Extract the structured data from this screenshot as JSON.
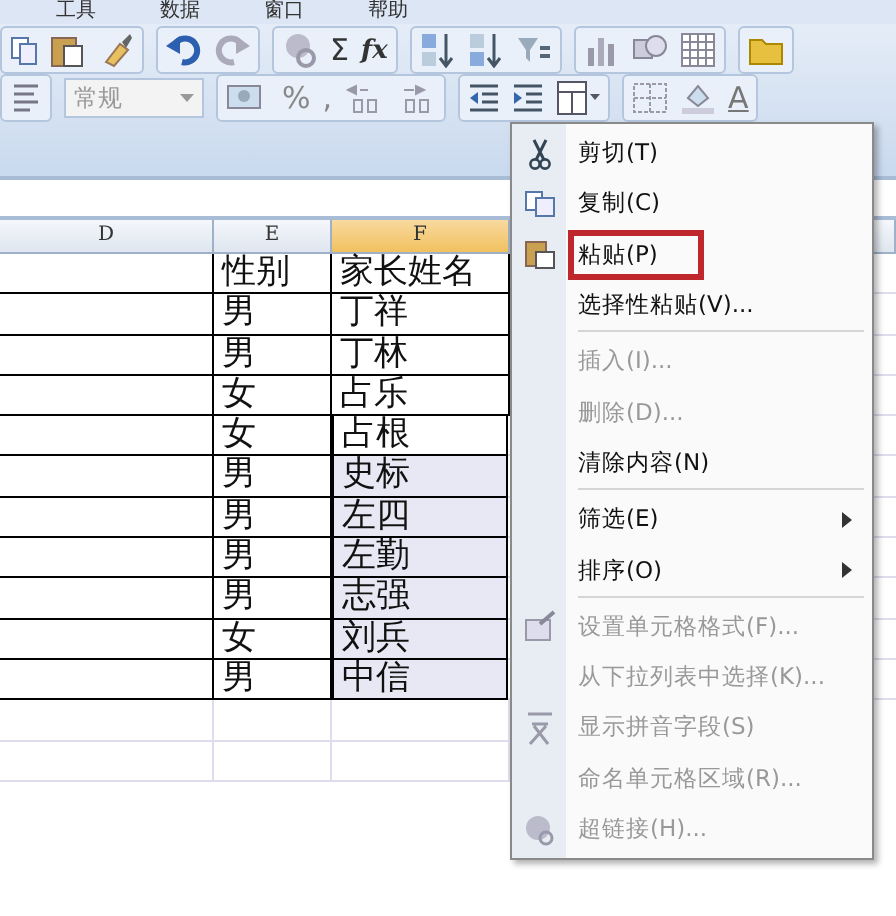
{
  "menubar": [
    {
      "label": "工具"
    },
    {
      "label": "数据"
    },
    {
      "label": "窗口"
    },
    {
      "label": "帮助"
    }
  ],
  "toolbar": {
    "sum_label": "Σ",
    "function_label": "fx",
    "number_format": {
      "value": "常规",
      "disabled": true
    },
    "percent_label": "%",
    "comma_label": ",",
    "font_color_label": "A"
  },
  "sheet": {
    "columns": [
      {
        "label": "D",
        "selected": false
      },
      {
        "label": "E",
        "selected": false
      },
      {
        "label": "F",
        "selected": true
      }
    ],
    "rows": [
      {
        "gender": "性别",
        "parent_name": "家长姓名",
        "selected": false
      },
      {
        "gender": "男",
        "parent_name": "丁祥",
        "selected": false
      },
      {
        "gender": "男",
        "parent_name": "丁林",
        "selected": false
      },
      {
        "gender": "女",
        "parent_name": "占乐",
        "selected": false
      },
      {
        "gender": "女",
        "parent_name": "占根",
        "selected": true
      },
      {
        "gender": "男",
        "parent_name": "史标",
        "selected": true
      },
      {
        "gender": "男",
        "parent_name": "左四",
        "selected": true
      },
      {
        "gender": "男",
        "parent_name": "左勤",
        "selected": true
      },
      {
        "gender": "男",
        "parent_name": "志强",
        "selected": true
      },
      {
        "gender": "女",
        "parent_name": "刘兵",
        "selected": true
      },
      {
        "gender": "男",
        "parent_name": "中信",
        "selected": true
      }
    ]
  },
  "context_menu": [
    {
      "label": "剪切(T)",
      "disabled": false,
      "submenu": false,
      "highlighted": false,
      "separator_before": false
    },
    {
      "label": "复制(C)",
      "disabled": false,
      "submenu": false,
      "highlighted": false,
      "separator_before": false
    },
    {
      "label": "粘贴(P)",
      "disabled": false,
      "submenu": false,
      "highlighted": true,
      "separator_before": false
    },
    {
      "label": "选择性粘贴(V)...",
      "disabled": false,
      "submenu": false,
      "highlighted": false,
      "separator_before": false
    },
    {
      "label": "插入(I)...",
      "disabled": true,
      "submenu": false,
      "highlighted": false,
      "separator_before": true
    },
    {
      "label": "删除(D)...",
      "disabled": true,
      "submenu": false,
      "highlighted": false,
      "separator_before": false
    },
    {
      "label": "清除内容(N)",
      "disabled": false,
      "submenu": false,
      "highlighted": false,
      "separator_before": false
    },
    {
      "label": "筛选(E)",
      "disabled": false,
      "submenu": true,
      "highlighted": false,
      "separator_before": true
    },
    {
      "label": "排序(O)",
      "disabled": false,
      "submenu": true,
      "highlighted": false,
      "separator_before": false
    },
    {
      "label": "设置单元格格式(F)...",
      "disabled": true,
      "submenu": false,
      "highlighted": false,
      "separator_before": true
    },
    {
      "label": "从下拉列表中选择(K)...",
      "disabled": true,
      "submenu": false,
      "highlighted": false,
      "separator_before": false
    },
    {
      "label": "显示拼音字段(S)",
      "disabled": true,
      "submenu": false,
      "highlighted": false,
      "separator_before": false
    },
    {
      "label": "命名单元格区域(R)...",
      "disabled": true,
      "submenu": false,
      "highlighted": false,
      "separator_before": false
    },
    {
      "label": "超链接(H)...",
      "disabled": true,
      "submenu": false,
      "highlighted": false,
      "separator_before": false
    }
  ]
}
